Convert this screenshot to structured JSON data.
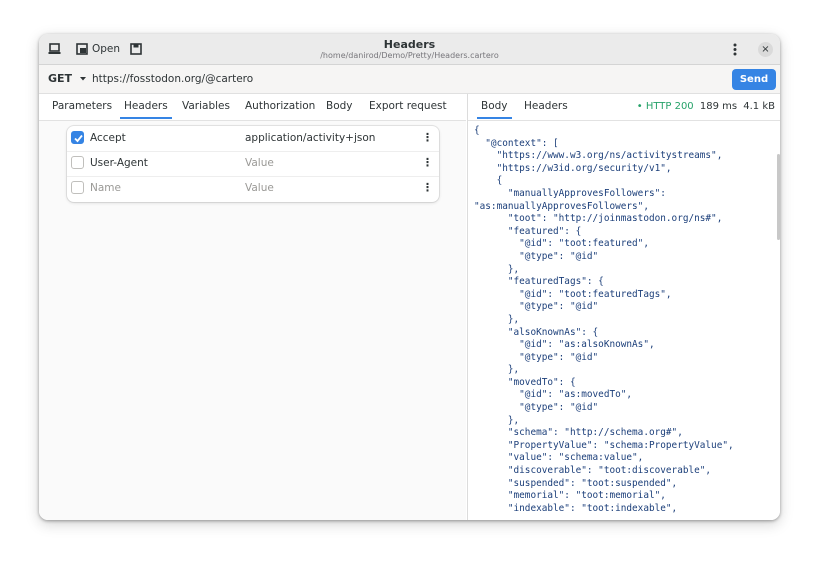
{
  "titlebar": {
    "title": "Headers",
    "subtitle": "/home/danirod/Demo/Pretty/Headers.cartero",
    "open_label": "Open"
  },
  "request": {
    "method": "GET",
    "url": "https://fosstodon.org/@cartero",
    "send_label": "Send"
  },
  "request_tabs": [
    "Parameters",
    "Headers",
    "Variables",
    "Authorization",
    "Body",
    "Export request"
  ],
  "headers": [
    {
      "name": "Accept",
      "value": "application/activity+json",
      "checked": true
    },
    {
      "name": "User-Agent",
      "value": "Value",
      "checked": false,
      "placeholder": true
    },
    {
      "name": "Name",
      "value": "Value",
      "checked": false,
      "placeholder": true
    }
  ],
  "response_tabs": [
    "Body",
    "Headers"
  ],
  "response_status": {
    "code": "HTTP 200",
    "time": "189 ms",
    "size": "4.1 kB"
  },
  "response_body": "{\n  \"@context\": [\n    \"https://www.w3.org/ns/activitystreams\",\n    \"https://w3id.org/security/v1\",\n    {\n      \"manuallyApprovesFollowers\":\n\"as:manuallyApprovesFollowers\",\n      \"toot\": \"http://joinmastodon.org/ns#\",\n      \"featured\": {\n        \"@id\": \"toot:featured\",\n        \"@type\": \"@id\"\n      },\n      \"featuredTags\": {\n        \"@id\": \"toot:featuredTags\",\n        \"@type\": \"@id\"\n      },\n      \"alsoKnownAs\": {\n        \"@id\": \"as:alsoKnownAs\",\n        \"@type\": \"@id\"\n      },\n      \"movedTo\": {\n        \"@id\": \"as:movedTo\",\n        \"@type\": \"@id\"\n      },\n      \"schema\": \"http://schema.org#\",\n      \"PropertyValue\": \"schema:PropertyValue\",\n      \"value\": \"schema:value\",\n      \"discoverable\": \"toot:discoverable\",\n      \"suspended\": \"toot:suspended\",\n      \"memorial\": \"toot:memorial\",\n      \"indexable\": \"toot:indexable\",",
  "icons": {
    "new": "new-window-icon",
    "open": "document-open-icon",
    "save": "save-icon",
    "menu": "kebab-menu-icon",
    "close": "close-icon",
    "dropdown": "chevron-down-icon"
  },
  "colors": {
    "accent": "#3584e4",
    "status_ok": "#26a269",
    "code_text": "#1c3f7a"
  }
}
